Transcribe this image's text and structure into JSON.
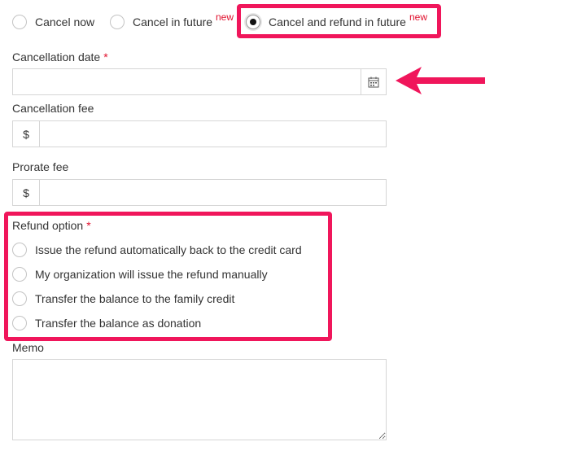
{
  "cancel_type": {
    "options": [
      {
        "label": "Cancel now",
        "new_badge": "",
        "selected": false
      },
      {
        "label": "Cancel in future",
        "new_badge": "new",
        "selected": false
      },
      {
        "label": "Cancel and refund in future",
        "new_badge": "new",
        "selected": true
      }
    ]
  },
  "cancellation_date": {
    "label": "Cancellation date",
    "required_mark": "*",
    "value": "",
    "icon": "calendar-icon"
  },
  "cancellation_fee": {
    "label": "Cancellation fee",
    "currency": "$",
    "value": ""
  },
  "prorate_fee": {
    "label": "Prorate fee",
    "currency": "$",
    "value": ""
  },
  "refund_option": {
    "label": "Refund option",
    "required_mark": "*",
    "options": [
      {
        "label": "Issue the refund automatically back to the credit card",
        "selected": false
      },
      {
        "label": "My organization will issue the refund manually",
        "selected": false
      },
      {
        "label": "Transfer the balance to the family credit",
        "selected": false
      },
      {
        "label": "Transfer the balance as donation",
        "selected": false
      }
    ]
  },
  "memo": {
    "label": "Memo",
    "value": ""
  },
  "annotations": {
    "color": "#f0165b",
    "arrow": "arrow-left-icon"
  }
}
